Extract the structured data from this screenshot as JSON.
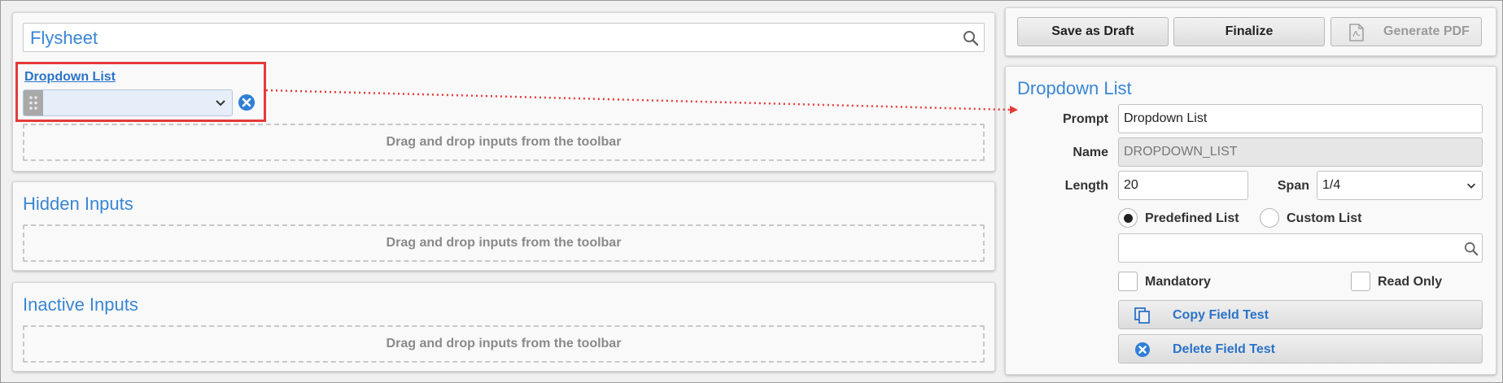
{
  "form": {
    "search_value": "Flysheet",
    "field_label": "Dropdown List",
    "dropzone_text": "Drag and drop inputs from the toolbar"
  },
  "sections": {
    "hidden_title": "Hidden Inputs",
    "hidden_dropzone": "Drag and drop inputs from the toolbar",
    "inactive_title": "Inactive Inputs",
    "inactive_dropzone": "Drag and drop inputs from the toolbar"
  },
  "toolbar": {
    "save_draft_label": "Save as Draft",
    "finalize_label": "Finalize",
    "generate_pdf_label": "Generate PDF"
  },
  "properties": {
    "title": "Dropdown List",
    "prompt_label": "Prompt",
    "prompt_value": "Dropdown List",
    "name_label": "Name",
    "name_value": "DROPDOWN_LIST",
    "length_label": "Length",
    "length_value": "20",
    "span_label": "Span",
    "span_value": "1/4",
    "predefined_label": "Predefined List",
    "custom_label": "Custom List",
    "list_search_value": "",
    "mandatory_label": "Mandatory",
    "readonly_label": "Read Only",
    "copy_label": "Copy Field Test",
    "delete_label": "Delete Field Test"
  },
  "colors": {
    "accent": "#3a86d4",
    "highlight": "#e53a3a"
  }
}
